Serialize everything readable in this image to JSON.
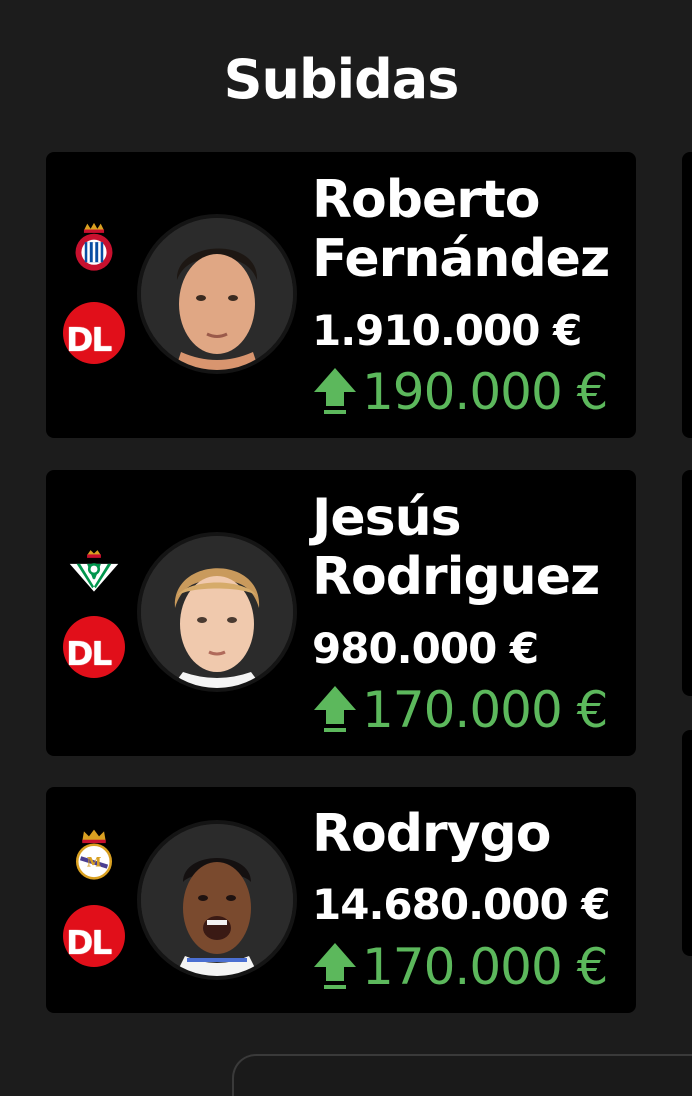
{
  "section_title": "Subidas",
  "colors": {
    "background": "#1c1c1c",
    "card": "#000000",
    "rise_green": "#5cb85c",
    "dl_badge": "#e10f1a"
  },
  "players": [
    {
      "name_line1": "Roberto",
      "name_line2": "Fernández",
      "value": "1.910.000 €",
      "rise": "190.000 €",
      "team_icon": "espanyol-crest-icon",
      "badge": "DL"
    },
    {
      "name_line1": "Jesús",
      "name_line2": "Rodriguez",
      "value": "980.000 €",
      "rise": "170.000 €",
      "team_icon": "real-betis-crest-icon",
      "badge": "DL"
    },
    {
      "name_line1": "Rodrygo",
      "name_line2": "",
      "value": "14.680.000 €",
      "rise": "170.000 €",
      "team_icon": "real-madrid-crest-icon",
      "badge": "DL"
    }
  ]
}
